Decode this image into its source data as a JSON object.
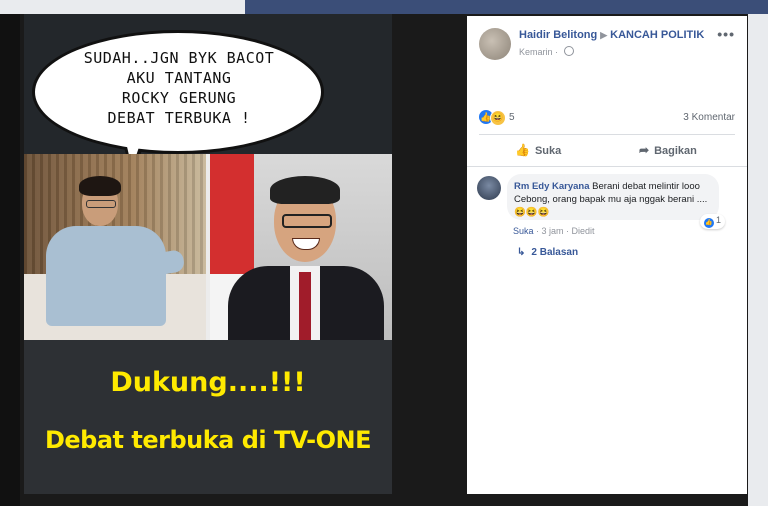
{
  "meme": {
    "bubble_lines": [
      "SUDAH..JGN BYK BACOT",
      "AKU TANTANG",
      "ROCKY GERUNG",
      "DEBAT TERBUKA  !"
    ],
    "caption_1": "Dukung....!!!",
    "caption_2": "Debat terbuka di TV-ONE"
  },
  "post": {
    "author": "Haidir Belitong",
    "group": "KANCAH POLITIK",
    "time": "Kemarin",
    "more_label": "•••",
    "reaction_count": "5",
    "comment_count": "3 Komentar",
    "like_label": "Suka",
    "share_label": "Bagikan"
  },
  "comment": {
    "author": "Rm Edy Karyana",
    "text": "Berani debat melintir looo Cebong, orang bapak mu aja nggak berani ....",
    "emojis": "😆😆😆",
    "reaction_count": "1",
    "like_link": "Suka",
    "time": "3 jam",
    "edited": "Diedit",
    "replies": "2 Balasan"
  },
  "colors": {
    "facebook_link": "#385898",
    "caption_yellow": "#ffea00",
    "like_blue": "#2078f4"
  }
}
